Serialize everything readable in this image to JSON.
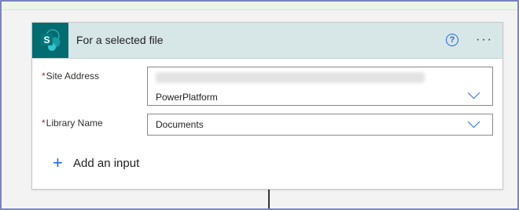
{
  "card": {
    "title": "For a selected file",
    "icon": "sharepoint-icon",
    "help_glyph": "?",
    "more_glyph": "···"
  },
  "fields": {
    "site_address": {
      "required_mark": "*",
      "label": "Site Address",
      "value": "PowerPlatform"
    },
    "library_name": {
      "required_mark": "*",
      "label": "Library Name",
      "value": "Documents"
    }
  },
  "actions": {
    "add_input_glyph": "+",
    "add_input_label": "Add an input"
  },
  "colors": {
    "accent": "#2266e3",
    "sharepoint": "#036c70",
    "header_bg": "#d7e6e7",
    "required": "#a4262c"
  }
}
